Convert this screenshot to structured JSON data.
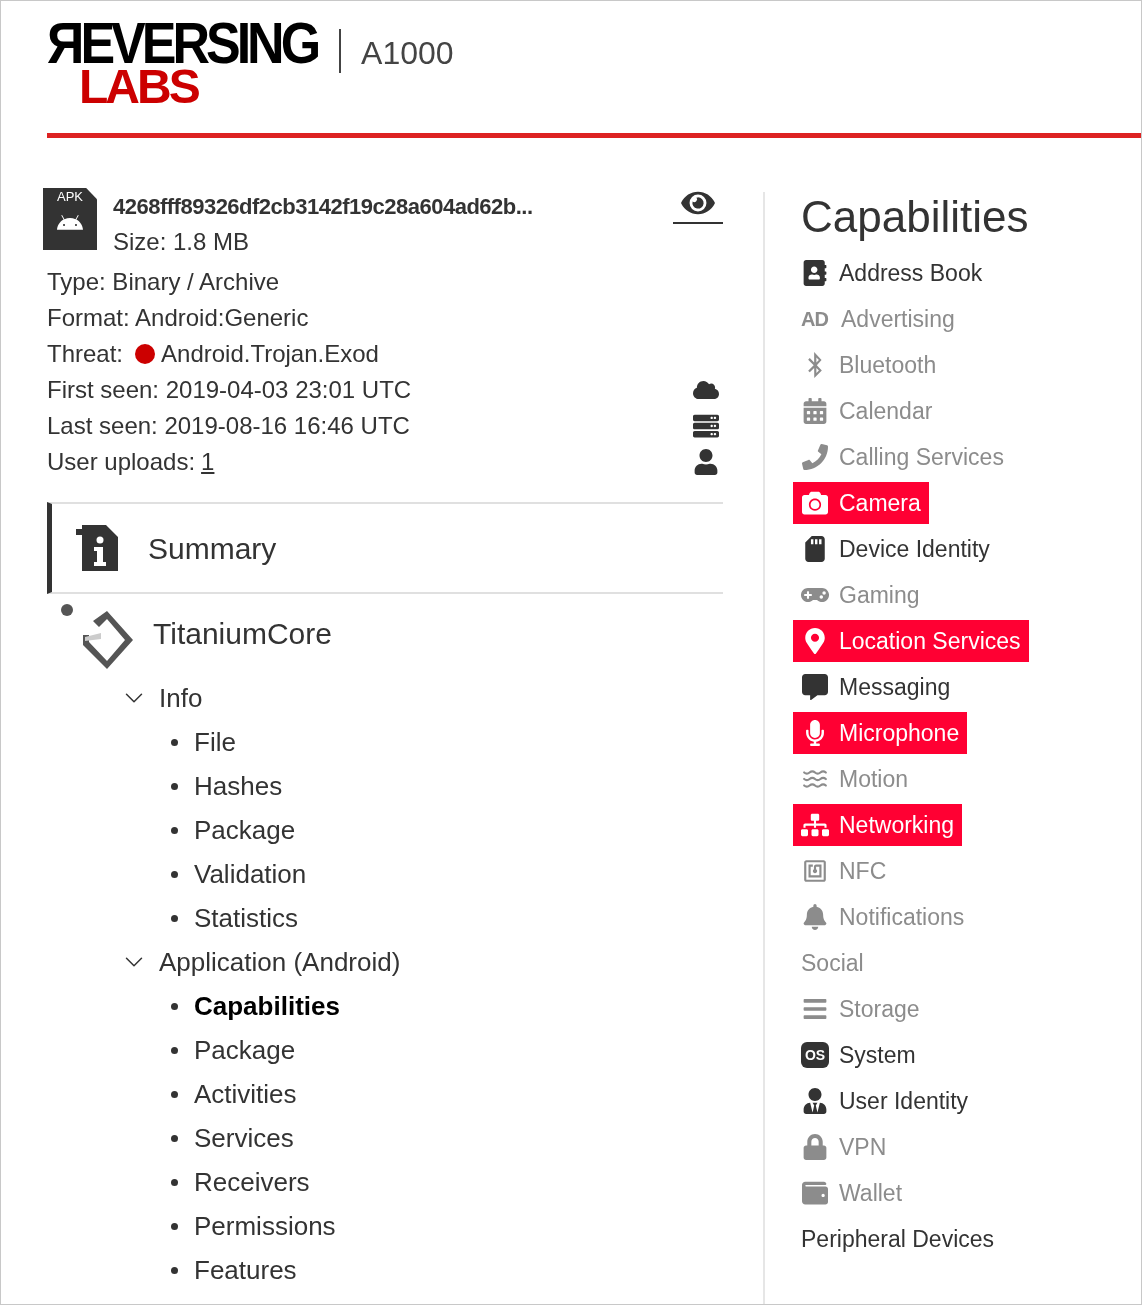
{
  "header": {
    "logo_top": "ЯEVERSING",
    "logo_bottom": "LABS",
    "product": "A1000"
  },
  "file": {
    "type_badge": "APK",
    "hash": "4268fff89326df2cb3142f19c28a604ad62b...",
    "size": "Size: 1.8 MB",
    "details": [
      {
        "kind": "text",
        "text": "Type: Binary / Archive"
      },
      {
        "kind": "text",
        "text": "Format: Android:Generic"
      },
      {
        "kind": "threat",
        "label": "Threat:",
        "value": "Android.Trojan.Exod",
        "color": "#cc0000"
      },
      {
        "kind": "text",
        "text": "First seen: 2019-04-03 23:01 UTC"
      },
      {
        "kind": "text",
        "text": "Last seen: 2019-08-16 16:46 UTC"
      },
      {
        "kind": "link",
        "label": "User uploads:",
        "value": "1"
      }
    ]
  },
  "nav": {
    "summary": {
      "label": "Summary",
      "selected": true
    },
    "engine": {
      "label": "TitaniumCore"
    },
    "tree": [
      {
        "label": "Info",
        "expanded": true,
        "children": [
          {
            "label": "File",
            "selected": false
          },
          {
            "label": "Hashes",
            "selected": false
          },
          {
            "label": "Package",
            "selected": false
          },
          {
            "label": "Validation",
            "selected": false
          },
          {
            "label": "Statistics",
            "selected": false
          }
        ]
      },
      {
        "label": "Application (Android)",
        "expanded": true,
        "children": [
          {
            "label": "Capabilities",
            "selected": true
          },
          {
            "label": "Package",
            "selected": false
          },
          {
            "label": "Activities",
            "selected": false
          },
          {
            "label": "Services",
            "selected": false
          },
          {
            "label": "Receivers",
            "selected": false
          },
          {
            "label": "Permissions",
            "selected": false
          },
          {
            "label": "Features",
            "selected": false
          }
        ]
      }
    ]
  },
  "capabilities": {
    "title": "Capabilities",
    "items": [
      {
        "label": "Address Book",
        "highlighted": false,
        "disabled": false
      },
      {
        "label": "Advertising",
        "highlighted": false,
        "disabled": true,
        "badge": "AD"
      },
      {
        "label": "Bluetooth",
        "highlighted": false,
        "disabled": true
      },
      {
        "label": "Calendar",
        "highlighted": false,
        "disabled": true
      },
      {
        "label": "Calling Services",
        "highlighted": false,
        "disabled": true
      },
      {
        "label": "Camera",
        "highlighted": true,
        "disabled": false
      },
      {
        "label": "Device Identity",
        "highlighted": false,
        "disabled": false
      },
      {
        "label": "Gaming",
        "highlighted": false,
        "disabled": true
      },
      {
        "label": "Location Services",
        "highlighted": true,
        "disabled": false
      },
      {
        "label": "Messaging",
        "highlighted": false,
        "disabled": false
      },
      {
        "label": "Microphone",
        "highlighted": true,
        "disabled": false
      },
      {
        "label": "Motion",
        "highlighted": false,
        "disabled": true
      },
      {
        "label": "Networking",
        "highlighted": true,
        "disabled": false
      },
      {
        "label": "NFC",
        "highlighted": false,
        "disabled": true
      },
      {
        "label": "Notifications",
        "highlighted": false,
        "disabled": true
      },
      {
        "label": "Social",
        "highlighted": false,
        "disabled": true
      },
      {
        "label": "Storage",
        "highlighted": false,
        "disabled": true
      },
      {
        "label": "System",
        "highlighted": false,
        "disabled": false,
        "badge": "OS"
      },
      {
        "label": "User Identity",
        "highlighted": false,
        "disabled": false
      },
      {
        "label": "VPN",
        "highlighted": false,
        "disabled": true
      },
      {
        "label": "Wallet",
        "highlighted": false,
        "disabled": true
      },
      {
        "label": "Peripheral Devices",
        "highlighted": false,
        "disabled": false
      }
    ]
  }
}
